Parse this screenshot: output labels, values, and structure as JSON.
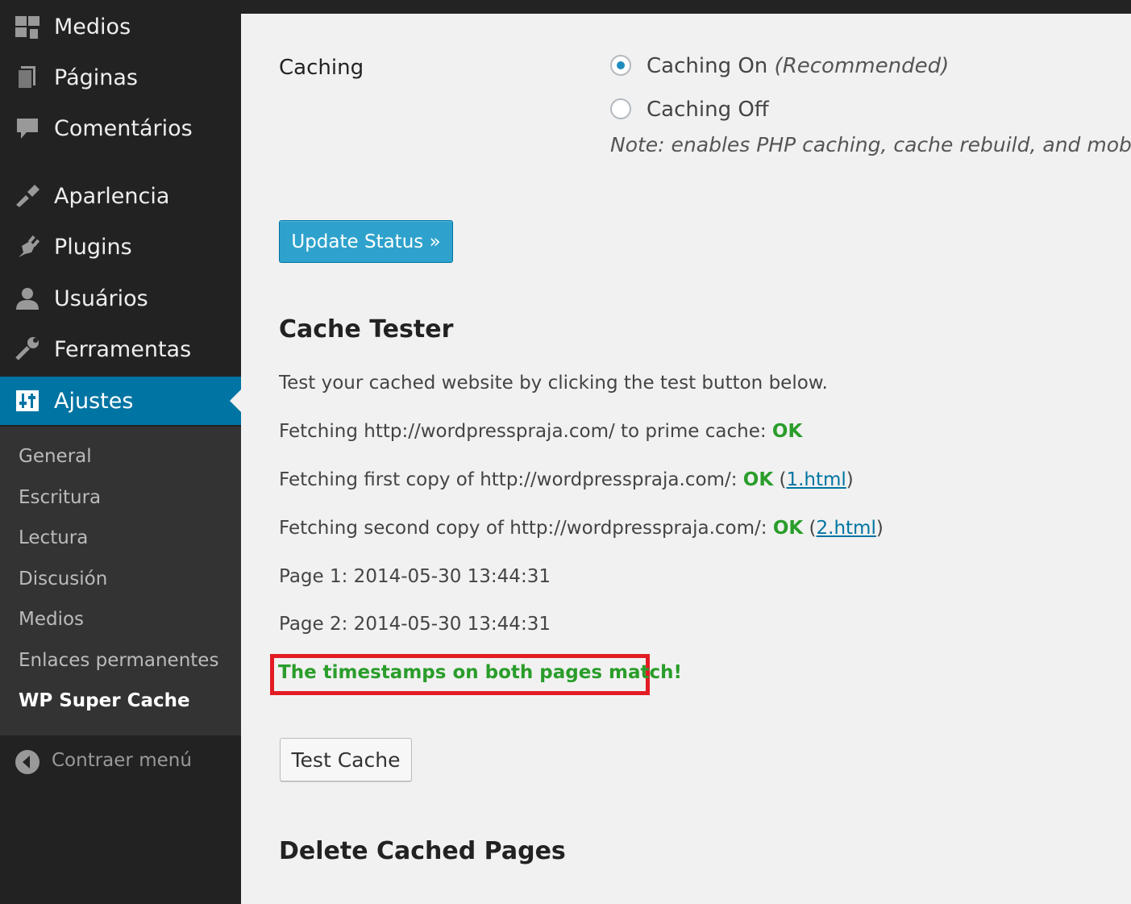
{
  "sidebar": {
    "items": [
      {
        "label": "Medios",
        "icon": "media-icon"
      },
      {
        "label": "Páginas",
        "icon": "pages-icon"
      },
      {
        "label": "Comentários",
        "icon": "comments-icon"
      },
      {
        "label": "Aparlencia",
        "icon": "appearance-icon"
      },
      {
        "label": "Plugins",
        "icon": "plugins-icon"
      },
      {
        "label": "Usuários",
        "icon": "users-icon"
      },
      {
        "label": "Ferramentas",
        "icon": "tools-icon"
      },
      {
        "label": "Ajustes",
        "icon": "settings-icon",
        "active": true
      }
    ],
    "submenu": [
      "General",
      "Escritura",
      "Lectura",
      "Discusión",
      "Medios",
      "Enlaces permanentes",
      "WP Super Cache"
    ],
    "collapse_label": "Contraer menú",
    "active_color": "#0074a2"
  },
  "caching": {
    "label": "Caching",
    "on_label": "Caching On",
    "on_recommended": "(Recommended)",
    "off_label": "Caching Off",
    "selected": "on",
    "note": "Note: enables PHP caching, cache rebuild, and mobile s",
    "update_button": "Update Status »"
  },
  "tester": {
    "title": "Cache Tester",
    "intro": "Test your cached website by clicking the test button below.",
    "line1_prefix": "Fetching http://wordpresspraja.com/ to prime cache: ",
    "line1_status": "OK",
    "line2_prefix": "Fetching first copy of http://wordpresspraja.com/: ",
    "line2_status": "OK",
    "line2_link": "1.html",
    "line3_prefix": "Fetching second copy of http://wordpresspraja.com/: ",
    "line3_status": "OK",
    "line3_link": "2.html",
    "page1": "Page 1: 2014-05-30 13:44:31",
    "page2": "Page 2: 2014-05-30 13:44:31",
    "match_message": "The timestamps on both pages match!",
    "test_button": "Test Cache"
  },
  "delete_section": {
    "title": "Delete Cached Pages"
  }
}
